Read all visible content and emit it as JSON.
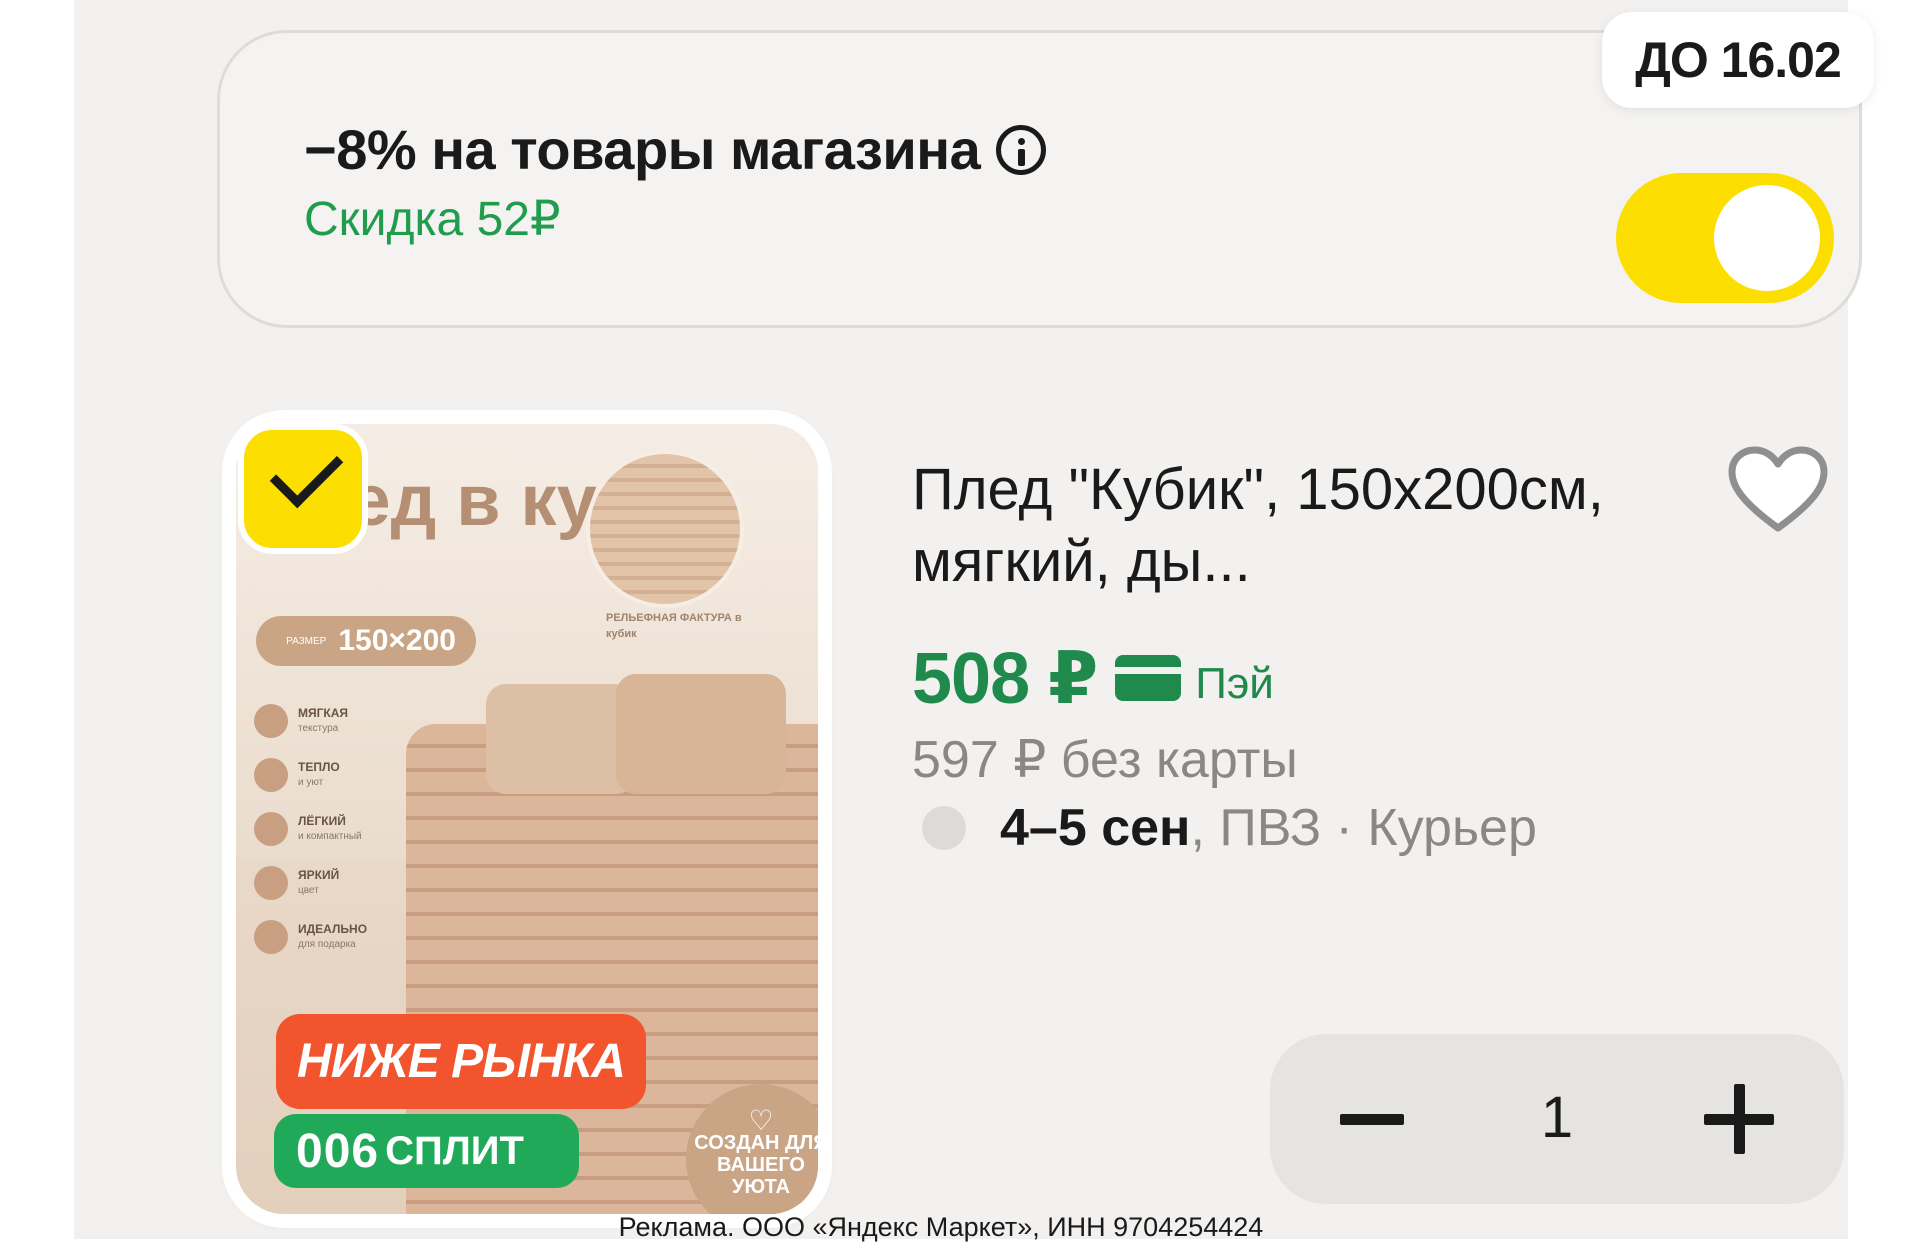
{
  "promo": {
    "title": "−8% на товары магазина",
    "discount": "Скидка 52₽",
    "deadline": "ДО 16.02",
    "toggle_on": true
  },
  "product": {
    "image_text": {
      "title": "Плед в кубик",
      "size_caption": "РАЗМЕР",
      "size": "150×200",
      "swatch_caption": "РЕЛЬЕФНАЯ ФАКТУРА в кубик",
      "features": [
        {
          "title": "МЯГКАЯ",
          "sub": "текстура"
        },
        {
          "title": "ТЕПЛО",
          "sub": "и уют"
        },
        {
          "title": "ЛЁГКИЙ",
          "sub": "и компактный"
        },
        {
          "title": "ЯРКИЙ",
          "sub": "цвет"
        },
        {
          "title": "ИДЕАЛЬНО",
          "sub": "для подарка"
        }
      ],
      "created": "СОЗДАН ДЛЯ ВАШЕГО УЮТА"
    },
    "badge_market": "НИЖЕ РЫНКА",
    "badge_split_num": "006",
    "badge_split_label": "СПЛИТ",
    "name": "Плед \"Кубик\", 150х200см, мягкий, ды...",
    "price": "508 ₽",
    "pay_label": "Пэй",
    "old_price": "597 ₽ без карты",
    "delivery_date": "4–5 сен",
    "delivery_rest": ", ПВЗ · Курьер",
    "quantity": "1",
    "selected": true
  },
  "icons": {
    "info": "info-icon",
    "check": "check-icon",
    "favorite": "heart-icon",
    "card": "card-icon",
    "minus": "minus-icon",
    "plus": "plus-icon"
  },
  "colors": {
    "accent_yellow": "#fcdf00",
    "green": "#1f8a4c",
    "badge_red": "#f2552e",
    "badge_green": "#21a95a"
  },
  "ad_text": "Реклама. ООО «Яндекс Маркет», ИНН 9704254424"
}
